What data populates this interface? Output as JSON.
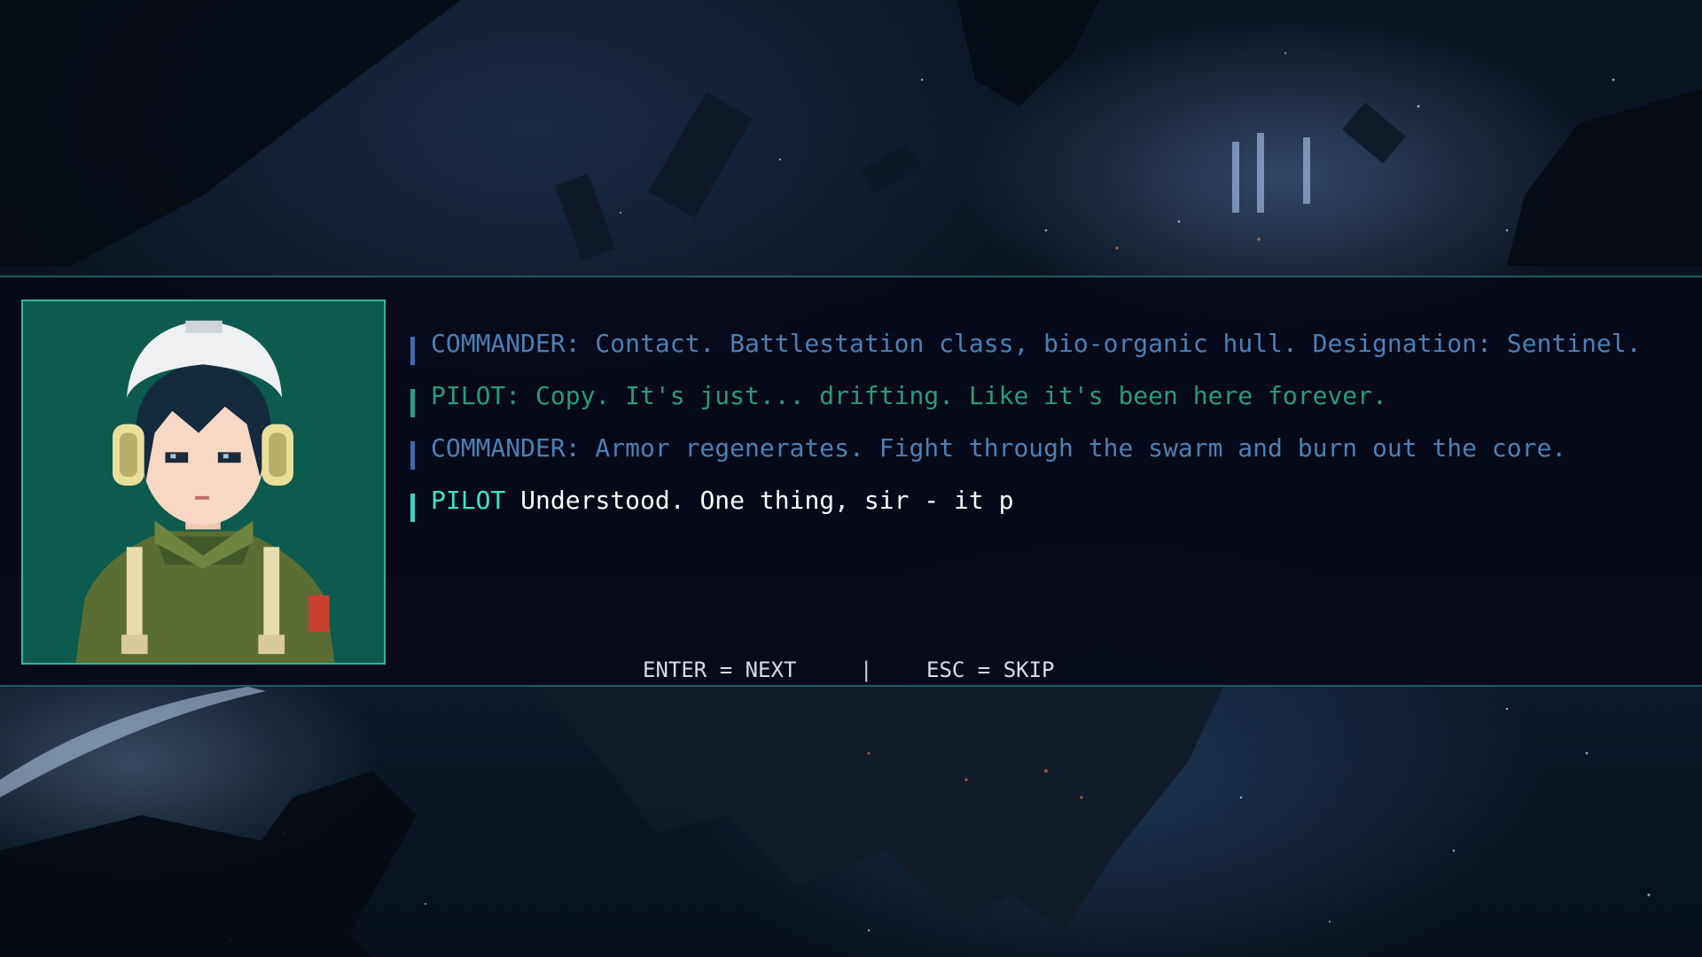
{
  "dialog": {
    "portrait": {
      "character": "pilot",
      "icon": "pilot-portrait"
    },
    "lines": [
      {
        "text": "COMMANDER: Contact. Battlestation class, bio-organic hull. Designation: Sentinel."
      },
      {
        "text": "PILOT: Copy. It's just... drifting. Like it's been here forever."
      },
      {
        "text": "COMMANDER: Armor regenerates. Fight through the swarm and burn out the core."
      }
    ],
    "current": {
      "speaker": "PILOT",
      "text": "Understood. One thing, sir - it p"
    }
  },
  "controls": {
    "next": "ENTER = NEXT",
    "separator": "|",
    "skip": "ESC = SKIP"
  },
  "colors": {
    "panel_border": "#1d5d63",
    "portrait_border": "#33b3a3",
    "commander_text": "#4d80b4",
    "pilot_text_old": "#2a9b7a",
    "current_speaker": "#3ee3c6",
    "current_text": "#ffffff"
  }
}
